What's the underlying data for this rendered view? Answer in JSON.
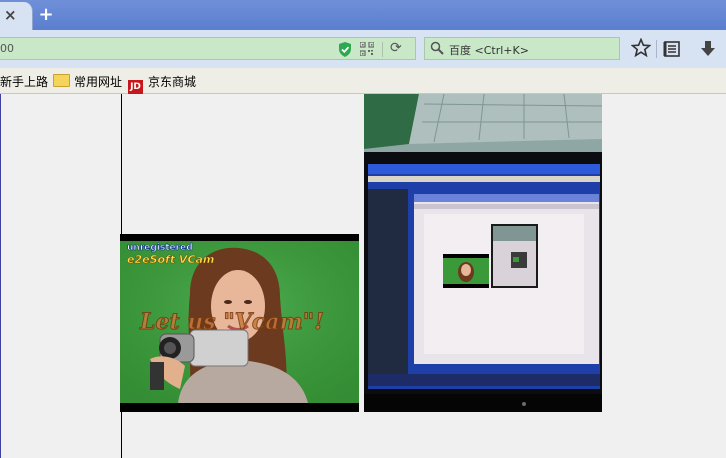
{
  "tabs": {
    "close_glyph": "×",
    "new_tab_glyph": "+"
  },
  "navbar": {
    "url_text": "00",
    "search_placeholder": "百度 <Ctrl+K>",
    "reload_glyph": "⟳"
  },
  "bookmarks": [
    {
      "label": "新手上路",
      "icon": "none"
    },
    {
      "label": "常用网址",
      "icon": "folder-icon"
    },
    {
      "label": "京东商城",
      "icon": "jd-icon",
      "badge": "JD"
    }
  ],
  "video1": {
    "unregistered": "unregistered",
    "brand": "e2eSoft VCam",
    "slogan": "Let us \"Vcam\"!"
  },
  "colors": {
    "tabbar": "#6f8fd8",
    "urlbar": "#c8e8c8",
    "toolbar": "#d7e2f2",
    "green_screen": "#3a9a3a"
  }
}
